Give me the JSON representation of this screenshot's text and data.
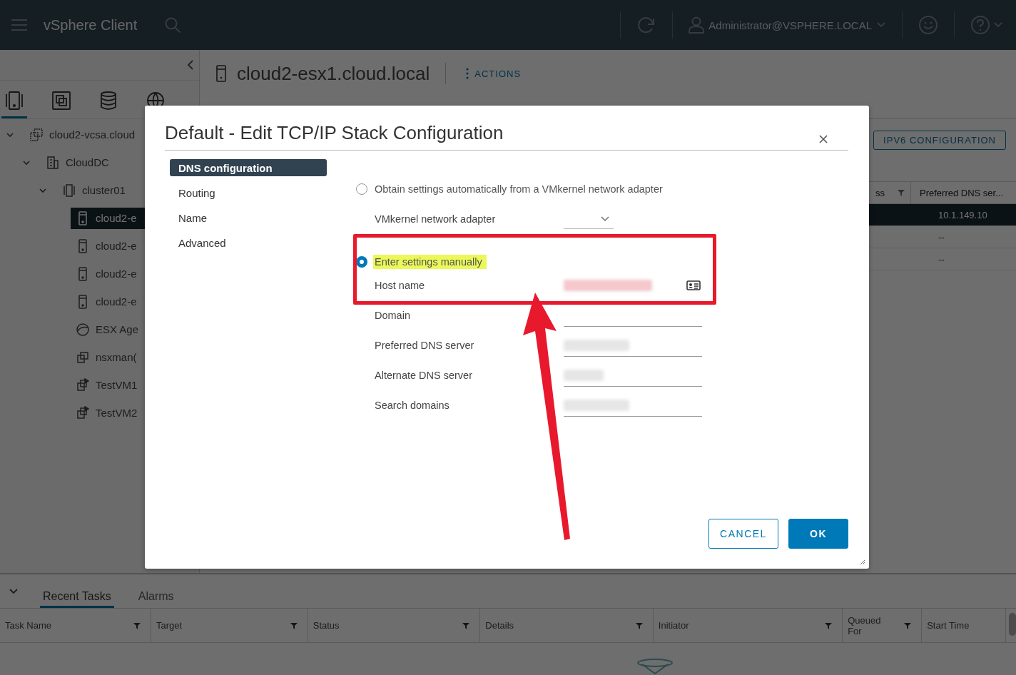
{
  "header": {
    "app_title": "vSphere Client",
    "user": "Administrator@VSPHERE.LOCAL"
  },
  "sidebar": {
    "view_tabs": [
      {
        "kind": "hosts",
        "selected": true
      },
      {
        "kind": "vms",
        "selected": false
      },
      {
        "kind": "storage",
        "selected": false
      },
      {
        "kind": "network",
        "selected": false
      }
    ],
    "tree": [
      {
        "label": "cloud2-vcsa.cloud",
        "kind": "vcenter",
        "expanded": true,
        "selected": false,
        "children": [
          {
            "label": "CloudDC",
            "kind": "datacenter",
            "expanded": true,
            "selected": false,
            "children": [
              {
                "label": "cluster01",
                "kind": "cluster",
                "expanded": true,
                "selected": false,
                "children": [
                  {
                    "label": "cloud2-e",
                    "kind": "host",
                    "selected": true
                  },
                  {
                    "label": "cloud2-e",
                    "kind": "host",
                    "selected": false
                  },
                  {
                    "label": "cloud2-e",
                    "kind": "host",
                    "selected": false
                  },
                  {
                    "label": "cloud2-e",
                    "kind": "host",
                    "selected": false
                  },
                  {
                    "label": "ESX Age",
                    "kind": "pool",
                    "selected": false
                  },
                  {
                    "label": "nsxman(",
                    "kind": "vm",
                    "selected": false
                  },
                  {
                    "label": "TestVM1",
                    "kind": "vm_on",
                    "selected": false
                  },
                  {
                    "label": "TestVM2",
                    "kind": "vm_on",
                    "selected": false
                  }
                ]
              }
            ]
          }
        ]
      }
    ]
  },
  "content": {
    "title": "cloud2-esx1.cloud.local",
    "actions": "ACTIONS",
    "ipv6_button": "IPV6 CONFIGURATION",
    "table": {
      "columns": [
        "ss",
        "Preferred DNS ser..."
      ],
      "rows": [
        {
          "preferred_dns": "10.1.149.10",
          "selected": true
        },
        {
          "preferred_dns": "--",
          "selected": false
        },
        {
          "preferred_dns": "--",
          "selected": false
        }
      ]
    }
  },
  "dialog": {
    "title": "Default - Edit TCP/IP Stack Configuration",
    "nav": [
      {
        "label": "DNS configuration",
        "selected": true
      },
      {
        "label": "Routing",
        "selected": false
      },
      {
        "label": "Name",
        "selected": false
      },
      {
        "label": "Advanced",
        "selected": false
      }
    ],
    "options": [
      {
        "label": "Obtain settings automatically from a VMkernel network adapter",
        "selected": false,
        "highlighted": false
      },
      {
        "label": "Enter settings manually",
        "selected": true,
        "highlighted": true
      }
    ],
    "adapter_label": "VMkernel network adapter",
    "fields": [
      {
        "label": "Host name",
        "kind": "host",
        "redacted": true
      },
      {
        "label": "Domain",
        "kind": "text",
        "redacted": false
      },
      {
        "label": "Preferred DNS server",
        "kind": "text",
        "redacted": true
      },
      {
        "label": "Alternate DNS server",
        "kind": "text",
        "redacted": true
      },
      {
        "label": "Search domains",
        "kind": "text",
        "redacted": true
      }
    ],
    "buttons": [
      {
        "label": "CANCEL",
        "kind": "secondary"
      },
      {
        "label": "OK",
        "kind": "primary"
      }
    ]
  },
  "annotations": {
    "highlight_box": true,
    "arrow": true
  },
  "tasks": {
    "tabs": [
      {
        "label": "Recent Tasks",
        "selected": true
      },
      {
        "label": "Alarms",
        "selected": false
      }
    ],
    "columns": [
      {
        "label": "Task Name",
        "filter": true
      },
      {
        "label": "Target",
        "filter": true
      },
      {
        "label": "Status",
        "filter": true
      },
      {
        "label": "Details",
        "filter": true
      },
      {
        "label": "Initiator",
        "filter": true
      },
      {
        "label": "Queued For",
        "filter": true
      },
      {
        "label": "Start Time",
        "filter": false
      }
    ]
  }
}
